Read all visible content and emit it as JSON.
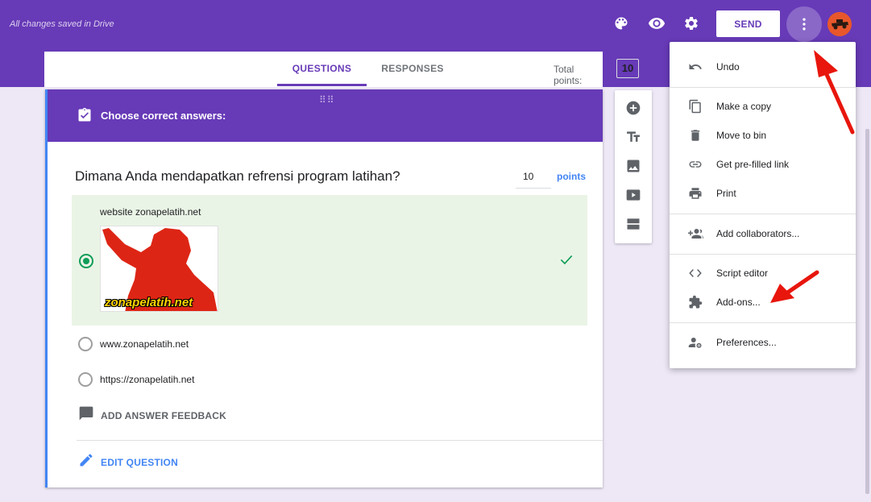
{
  "topbar": {
    "saved_status": "All changes saved in Drive",
    "send_label": "SEND",
    "icons": [
      "palette-icon",
      "eye-icon",
      "gear-icon",
      "more-vert-icon",
      "avatar"
    ],
    "color": "#673ab7"
  },
  "tabs": {
    "questions": "QUESTIONS",
    "responses": "RESPONSES",
    "total_points_label": "Total points:",
    "total_points_value": "10"
  },
  "question": {
    "header_title": "Choose correct answers:",
    "text": "Dimana Anda mendapatkan refrensi program latihan?",
    "points_value": "10",
    "points_label": "points",
    "options": [
      {
        "label": "website zonapelatih.net",
        "correct": true,
        "selected": true,
        "image_caption": "zonapelatih.net"
      },
      {
        "label": "www.zonapelatih.net",
        "correct": false,
        "selected": false
      },
      {
        "label": "https://zonapelatih.net",
        "correct": false,
        "selected": false
      }
    ],
    "add_feedback_label": "ADD ANSWER FEEDBACK",
    "edit_question_label": "EDIT QUESTION"
  },
  "side_toolbar": [
    "add-question-icon",
    "add-title-icon",
    "add-image-icon",
    "add-video-icon",
    "add-section-icon"
  ],
  "menu": {
    "items": [
      {
        "label": "Undo",
        "icon": "undo-icon"
      },
      {
        "label": "Make a copy",
        "icon": "copy-icon"
      },
      {
        "label": "Move to bin",
        "icon": "trash-icon"
      },
      {
        "label": "Get pre-filled link",
        "icon": "link-icon"
      },
      {
        "label": "Print",
        "icon": "print-icon"
      },
      {
        "label": "Add collaborators...",
        "icon": "collaborators-icon"
      },
      {
        "label": "Script editor",
        "icon": "code-icon"
      },
      {
        "label": "Add-ons...",
        "icon": "puzzle-icon"
      },
      {
        "label": "Preferences...",
        "icon": "preferences-icon"
      }
    ]
  },
  "colors": {
    "accent": "#673ab7",
    "correct": "#0f9d58",
    "link": "#4285f4",
    "annotation": "#e8160c"
  }
}
